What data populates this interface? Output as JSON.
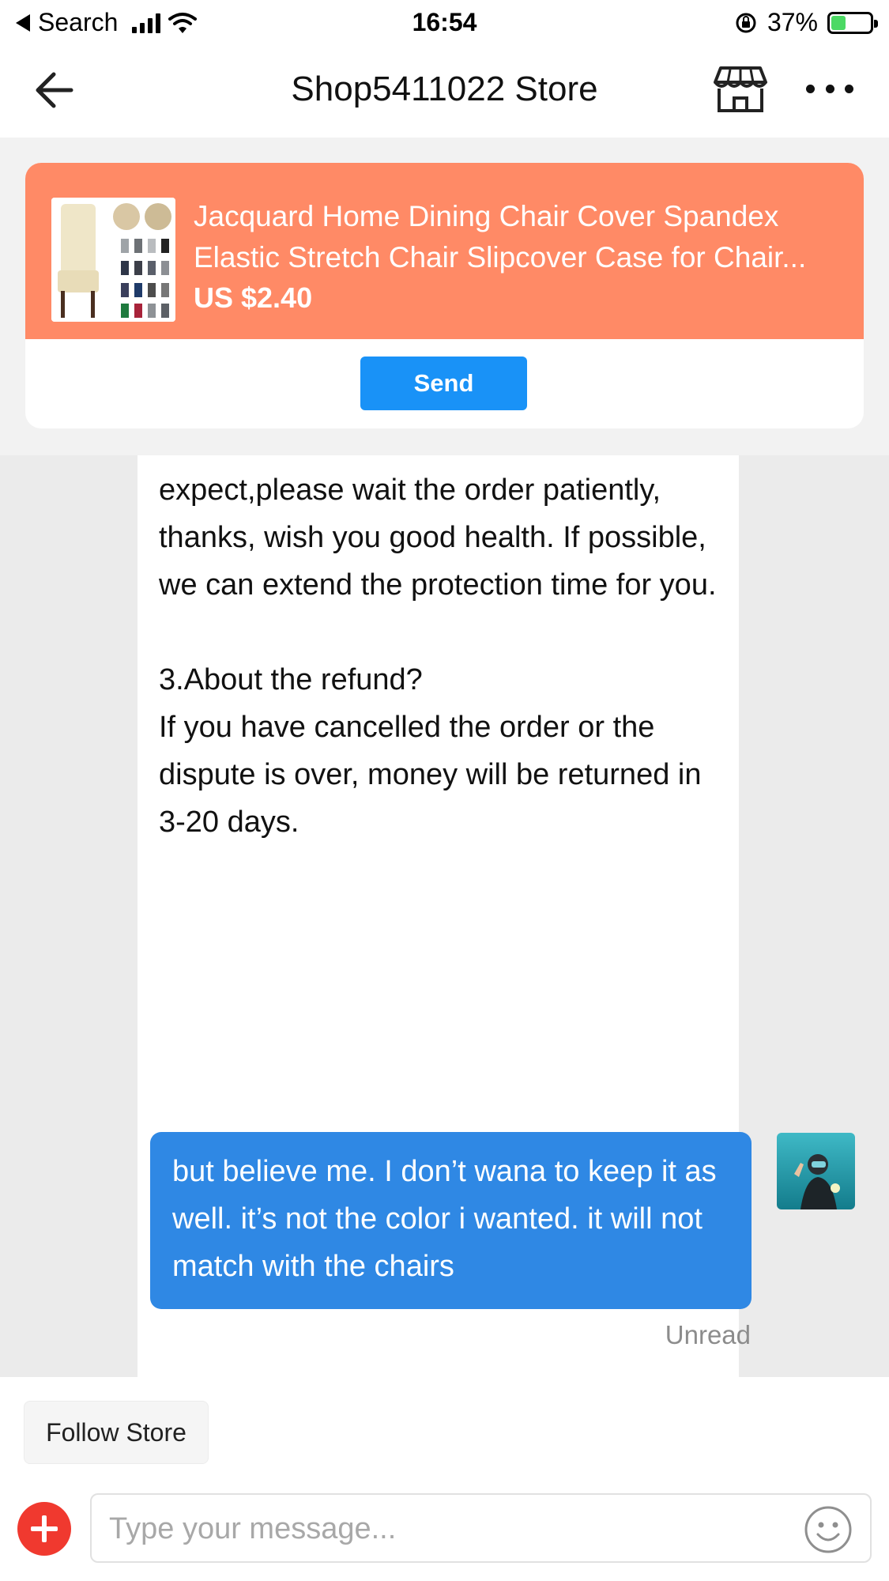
{
  "status_bar": {
    "back_app": "Search",
    "time": "16:54",
    "battery_percent": "37%",
    "battery_level": 0.37
  },
  "header": {
    "title": "Shop5411022 Store",
    "back_icon": "back-arrow-icon",
    "store_icon": "store-icon",
    "more_icon": "more-icon"
  },
  "product": {
    "title": "Jacquard Home Dining Chair Cover Spandex Elastic Stretch Chair Slipcover Case for Chair...",
    "price": "US $2.40",
    "send_label": "Send"
  },
  "chat": {
    "incoming_text": "expect,please wait the order patiently, thanks, wish you good health. If possible, we can extend the protection time for you.\n\n3.About the refund?\nIf you have cancelled the order or the dispute is over, money will be returned in 3-20 days.",
    "outgoing_text": "but believe me. I don’t wana to keep it as well. it’s not the color i wanted. it will not match with the chairs",
    "read_status": "Unread"
  },
  "footer": {
    "follow_label": "Follow Store",
    "input_placeholder": "Type your message...",
    "input_value": ""
  },
  "colors": {
    "accent_orange": "#ff8a66",
    "send_blue": "#1992f7",
    "outgoing_bubble": "#2f88e4",
    "plus_red": "#f0392f"
  }
}
